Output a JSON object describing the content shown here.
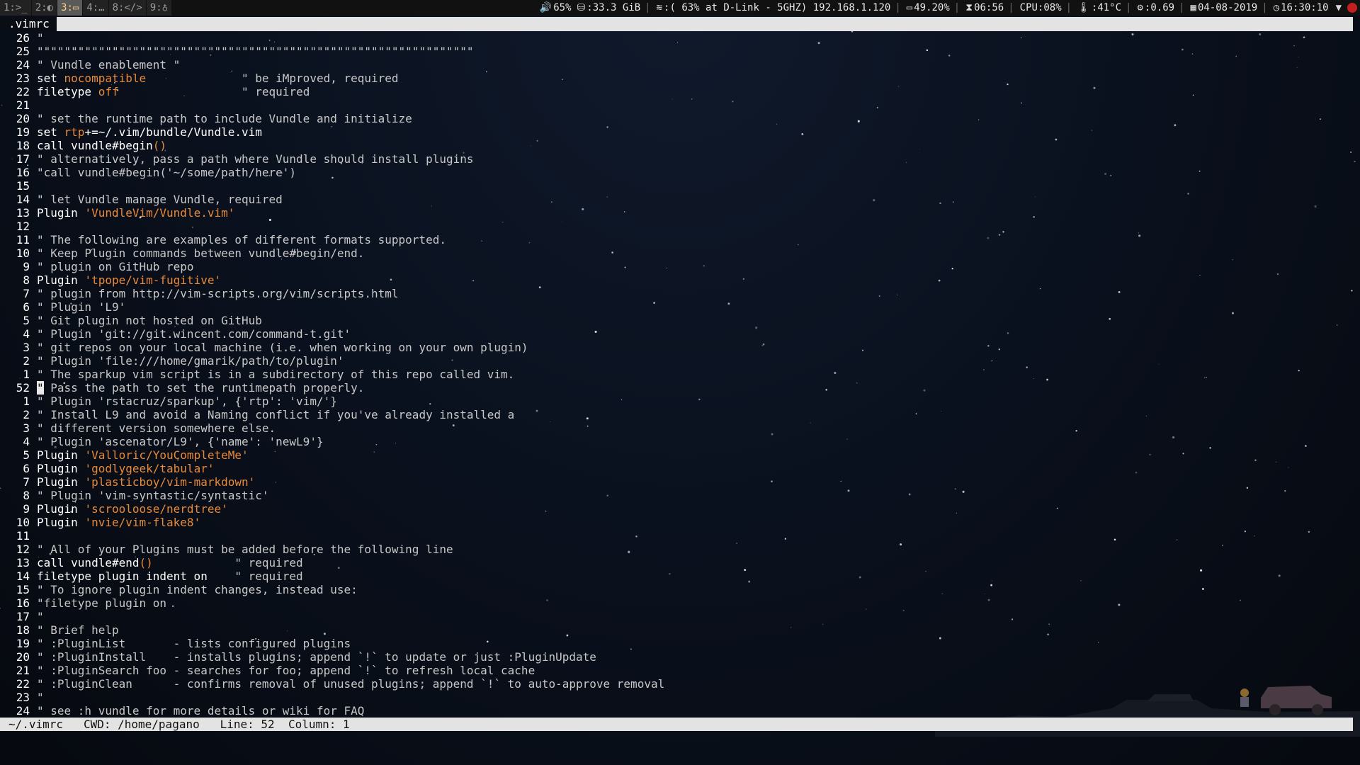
{
  "topbar": {
    "workspaces": [
      {
        "label": "1:>_",
        "active": false
      },
      {
        "label": "2:◐",
        "active": false
      },
      {
        "label": "3:▭",
        "active": true
      },
      {
        "label": "4:…",
        "active": false
      },
      {
        "label": "8:</>",
        "active": false
      },
      {
        "label": "9:♁",
        "active": false
      }
    ],
    "volume": "65%",
    "disk": "33.3 GiB",
    "wifi": "( 63% at D-Link - 5GHZ) 192.168.1.120",
    "battery": "49.20%",
    "battery_time": "06:56",
    "cpu": "CPU:08%",
    "temp": "41°C",
    "load": "0.69",
    "date": "04-08-2019",
    "time": "16:30:10"
  },
  "vim": {
    "tab_label": ".vimrc",
    "lines": [
      {
        "n": "26",
        "segments": [
          {
            "t": "\"",
            "c": "cm"
          }
        ]
      },
      {
        "n": "25",
        "segments": [
          {
            "t": "\"\"\"\"\"\"\"\"\"\"\"\"\"\"\"\"\"\"\"\"\"\"\"\"\"\"\"\"\"\"\"\"\"\"\"\"\"\"\"\"\"\"\"\"\"\"\"\"\"\"\"\"\"\"\"\"\"\"\"\"\"\"\"\"",
            "c": "cm"
          }
        ]
      },
      {
        "n": "24",
        "segments": [
          {
            "t": "\" Vundle enablement \"",
            "c": "cm"
          }
        ]
      },
      {
        "n": "23",
        "segments": [
          {
            "t": "set ",
            "c": ""
          },
          {
            "t": "nocompatible",
            "c": "str"
          },
          {
            "t": "              \" be iMproved, required",
            "c": "cm"
          }
        ]
      },
      {
        "n": "22",
        "segments": [
          {
            "t": "filetype ",
            "c": ""
          },
          {
            "t": "off",
            "c": "str"
          },
          {
            "t": "                  \" required",
            "c": "cm"
          }
        ]
      },
      {
        "n": "21",
        "segments": []
      },
      {
        "n": "20",
        "segments": [
          {
            "t": "\" set the runtime path to include Vundle and initialize",
            "c": "cm"
          }
        ]
      },
      {
        "n": "19",
        "segments": [
          {
            "t": "set ",
            "c": ""
          },
          {
            "t": "rtp",
            "c": "str"
          },
          {
            "t": "+=~/.vim/bundle/Vundle.vim",
            "c": ""
          }
        ]
      },
      {
        "n": "18",
        "segments": [
          {
            "t": "call vundle#begin",
            "c": ""
          },
          {
            "t": "()",
            "c": "str"
          }
        ]
      },
      {
        "n": "17",
        "segments": [
          {
            "t": "\" alternatively, pass a path where Vundle should install plugins",
            "c": "cm"
          }
        ]
      },
      {
        "n": "16",
        "segments": [
          {
            "t": "\"call vundle#begin('~/some/path/here')",
            "c": "cm"
          }
        ]
      },
      {
        "n": "15",
        "segments": []
      },
      {
        "n": "14",
        "segments": [
          {
            "t": "\" let Vundle manage Vundle, required",
            "c": "cm"
          }
        ]
      },
      {
        "n": "13",
        "segments": [
          {
            "t": "Plugin ",
            "c": ""
          },
          {
            "t": "'VundleVim/Vundle.vim'",
            "c": "str"
          }
        ]
      },
      {
        "n": "12",
        "segments": []
      },
      {
        "n": "11",
        "segments": [
          {
            "t": "\" The following are examples of different formats supported.",
            "c": "cm"
          }
        ]
      },
      {
        "n": "10",
        "segments": [
          {
            "t": "\" Keep Plugin commands between vundle#begin/end.",
            "c": "cm"
          }
        ]
      },
      {
        "n": "9",
        "segments": [
          {
            "t": "\" plugin on GitHub repo",
            "c": "cm"
          }
        ]
      },
      {
        "n": "8",
        "segments": [
          {
            "t": "Plugin ",
            "c": ""
          },
          {
            "t": "'tpope/vim-fugitive'",
            "c": "str"
          }
        ]
      },
      {
        "n": "7",
        "segments": [
          {
            "t": "\" plugin from http://vim-scripts.org/vim/scripts.html",
            "c": "cm"
          }
        ]
      },
      {
        "n": "6",
        "segments": [
          {
            "t": "\" Plugin 'L9'",
            "c": "cm"
          }
        ]
      },
      {
        "n": "5",
        "segments": [
          {
            "t": "\" Git plugin not hosted on GitHub",
            "c": "cm"
          }
        ]
      },
      {
        "n": "4",
        "segments": [
          {
            "t": "\" Plugin 'git://git.wincent.com/command-t.git'",
            "c": "cm"
          }
        ]
      },
      {
        "n": "3",
        "segments": [
          {
            "t": "\" git repos on your local machine (i.e. when working on your own plugin)",
            "c": "cm"
          }
        ]
      },
      {
        "n": "2",
        "segments": [
          {
            "t": "\" Plugin 'file:///home/gmarik/path/to/plugin'",
            "c": "cm"
          }
        ]
      },
      {
        "n": "1",
        "segments": [
          {
            "t": "\" The sparkup vim script is in a subdirectory of this repo called vim.",
            "c": "cm"
          }
        ]
      },
      {
        "n": "52",
        "current": true,
        "segments": [
          {
            "t": "\"",
            "c": "cursor"
          },
          {
            "t": " Pass the path to set the runtimepath properly.",
            "c": "cm"
          }
        ]
      },
      {
        "n": "1",
        "segments": [
          {
            "t": "\" Plugin 'rstacruz/sparkup', {'rtp': 'vim/'}",
            "c": "cm"
          }
        ]
      },
      {
        "n": "2",
        "segments": [
          {
            "t": "\" Install L9 and avoid a Naming conflict if you've already installed a",
            "c": "cm"
          }
        ]
      },
      {
        "n": "3",
        "segments": [
          {
            "t": "\" different version somewhere else.",
            "c": "cm"
          }
        ]
      },
      {
        "n": "4",
        "segments": [
          {
            "t": "\" Plugin 'ascenator/L9', {'name': 'newL9'}",
            "c": "cm"
          }
        ]
      },
      {
        "n": "5",
        "segments": [
          {
            "t": "Plugin ",
            "c": ""
          },
          {
            "t": "'Valloric/YouCompleteMe'",
            "c": "str"
          }
        ]
      },
      {
        "n": "6",
        "segments": [
          {
            "t": "Plugin ",
            "c": ""
          },
          {
            "t": "'godlygeek/tabular'",
            "c": "str"
          }
        ]
      },
      {
        "n": "7",
        "segments": [
          {
            "t": "Plugin ",
            "c": ""
          },
          {
            "t": "'plasticboy/vim-markdown'",
            "c": "str"
          }
        ]
      },
      {
        "n": "8",
        "segments": [
          {
            "t": "\" Plugin 'vim-syntastic/syntastic'",
            "c": "cm"
          }
        ]
      },
      {
        "n": "9",
        "segments": [
          {
            "t": "Plugin ",
            "c": ""
          },
          {
            "t": "'scrooloose/nerdtree'",
            "c": "str"
          }
        ]
      },
      {
        "n": "10",
        "segments": [
          {
            "t": "Plugin ",
            "c": ""
          },
          {
            "t": "'nvie/vim-flake8'",
            "c": "str"
          }
        ]
      },
      {
        "n": "11",
        "segments": []
      },
      {
        "n": "12",
        "segments": [
          {
            "t": "\" All of your Plugins must be added before the following line",
            "c": "cm"
          }
        ]
      },
      {
        "n": "13",
        "segments": [
          {
            "t": "call vundle#end",
            "c": ""
          },
          {
            "t": "()",
            "c": "str"
          },
          {
            "t": "            \" required",
            "c": "cm"
          }
        ]
      },
      {
        "n": "14",
        "segments": [
          {
            "t": "filetype plugin indent on",
            "c": ""
          },
          {
            "t": "    \" required",
            "c": "cm"
          }
        ]
      },
      {
        "n": "15",
        "segments": [
          {
            "t": "\" To ignore plugin indent changes, instead use:",
            "c": "cm"
          }
        ]
      },
      {
        "n": "16",
        "segments": [
          {
            "t": "\"filetype plugin on",
            "c": "cm"
          }
        ]
      },
      {
        "n": "17",
        "segments": [
          {
            "t": "\"",
            "c": "cm"
          }
        ]
      },
      {
        "n": "18",
        "segments": [
          {
            "t": "\" Brief help",
            "c": "cm"
          }
        ]
      },
      {
        "n": "19",
        "segments": [
          {
            "t": "\" :PluginList       - lists configured plugins",
            "c": "cm"
          }
        ]
      },
      {
        "n": "20",
        "segments": [
          {
            "t": "\" :PluginInstall    - installs plugins; append `!` to update or just :PluginUpdate",
            "c": "cm"
          }
        ]
      },
      {
        "n": "21",
        "segments": [
          {
            "t": "\" :PluginSearch foo - searches for foo; append `!` to refresh local cache",
            "c": "cm"
          }
        ]
      },
      {
        "n": "22",
        "segments": [
          {
            "t": "\" :PluginClean      - confirms removal of unused plugins; append `!` to auto-approve removal",
            "c": "cm"
          }
        ]
      },
      {
        "n": "23",
        "segments": [
          {
            "t": "\"",
            "c": "cm"
          }
        ]
      },
      {
        "n": "24",
        "segments": [
          {
            "t": "\" see :h vundle for more details or wiki for FAQ",
            "c": "cm"
          }
        ]
      }
    ],
    "statusline": "~/.vimrc   CWD: /home/pagano   Line: 52  Column: 1"
  },
  "colors": {
    "comment": "#c8c8c8",
    "string": "#e88a3a",
    "bar_bg": "#e3e3e3",
    "active_ws": "#ffd27a"
  }
}
